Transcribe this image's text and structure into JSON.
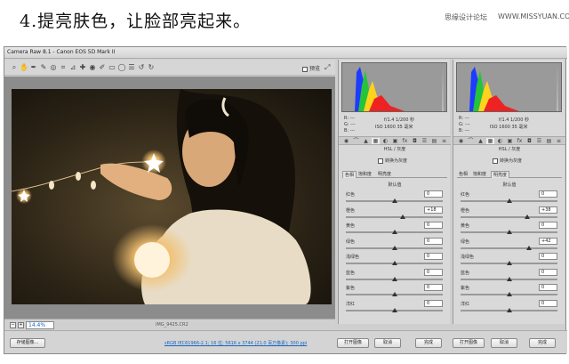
{
  "heading": "4.提亮肤色，让脸部亮起来。",
  "watermark": {
    "left": "思缘设计论坛",
    "right": "WWW.MISSYUAN.COM"
  },
  "window": {
    "title": "Camera Raw 8.1 - Canon EOS 5D Mark II"
  },
  "toolbar": {
    "preview_label": "预览"
  },
  "zoom": {
    "value": "14.4%"
  },
  "file": {
    "name": "IMG_9425.CR2"
  },
  "readout": {
    "rgb": [
      "R: ---",
      "G: ---",
      "B: ---"
    ],
    "exif_line1": "f/1.4  1/200 秒",
    "exif_line2": "ISO 1600  35 毫米"
  },
  "panel_title": "HSL / 灰度",
  "grayscale_label": "转换为灰度",
  "subtabs": [
    "色相",
    "饱和度",
    "明亮度"
  ],
  "default_label": "默认值",
  "left_panel": {
    "active_tab": 0,
    "sliders": [
      {
        "label": "红色",
        "value": "0",
        "pos": 0.5
      },
      {
        "label": "橙色",
        "value": "+18",
        "pos": 0.59
      },
      {
        "label": "黄色",
        "value": "0",
        "pos": 0.5
      },
      {
        "label": "绿色",
        "value": "0",
        "pos": 0.5
      },
      {
        "label": "浅绿色",
        "value": "0",
        "pos": 0.5
      },
      {
        "label": "蓝色",
        "value": "0",
        "pos": 0.5
      },
      {
        "label": "紫色",
        "value": "0",
        "pos": 0.5
      },
      {
        "label": "洋红",
        "value": "0",
        "pos": 0.5
      }
    ]
  },
  "right_panel": {
    "active_tab": 2,
    "sliders": [
      {
        "label": "红色",
        "value": "0",
        "pos": 0.5
      },
      {
        "label": "橙色",
        "value": "+38",
        "pos": 0.69
      },
      {
        "label": "黄色",
        "value": "0",
        "pos": 0.5
      },
      {
        "label": "绿色",
        "value": "+42",
        "pos": 0.71
      },
      {
        "label": "浅绿色",
        "value": "0",
        "pos": 0.5
      },
      {
        "label": "蓝色",
        "value": "0",
        "pos": 0.5
      },
      {
        "label": "紫色",
        "value": "0",
        "pos": 0.5
      },
      {
        "label": "洋红",
        "value": "0",
        "pos": 0.5
      }
    ]
  },
  "bottom": {
    "save_label": "存储图像...",
    "info": "sRGB IEC61966-2.1; 16 位; 5616 x 3744 (21.0 百万像素); 300 ppi",
    "open1": "打开图像",
    "cancel1": "取消",
    "done1": "完成",
    "open2": "打开图像",
    "cancel2": "取消",
    "done2": "完成"
  }
}
